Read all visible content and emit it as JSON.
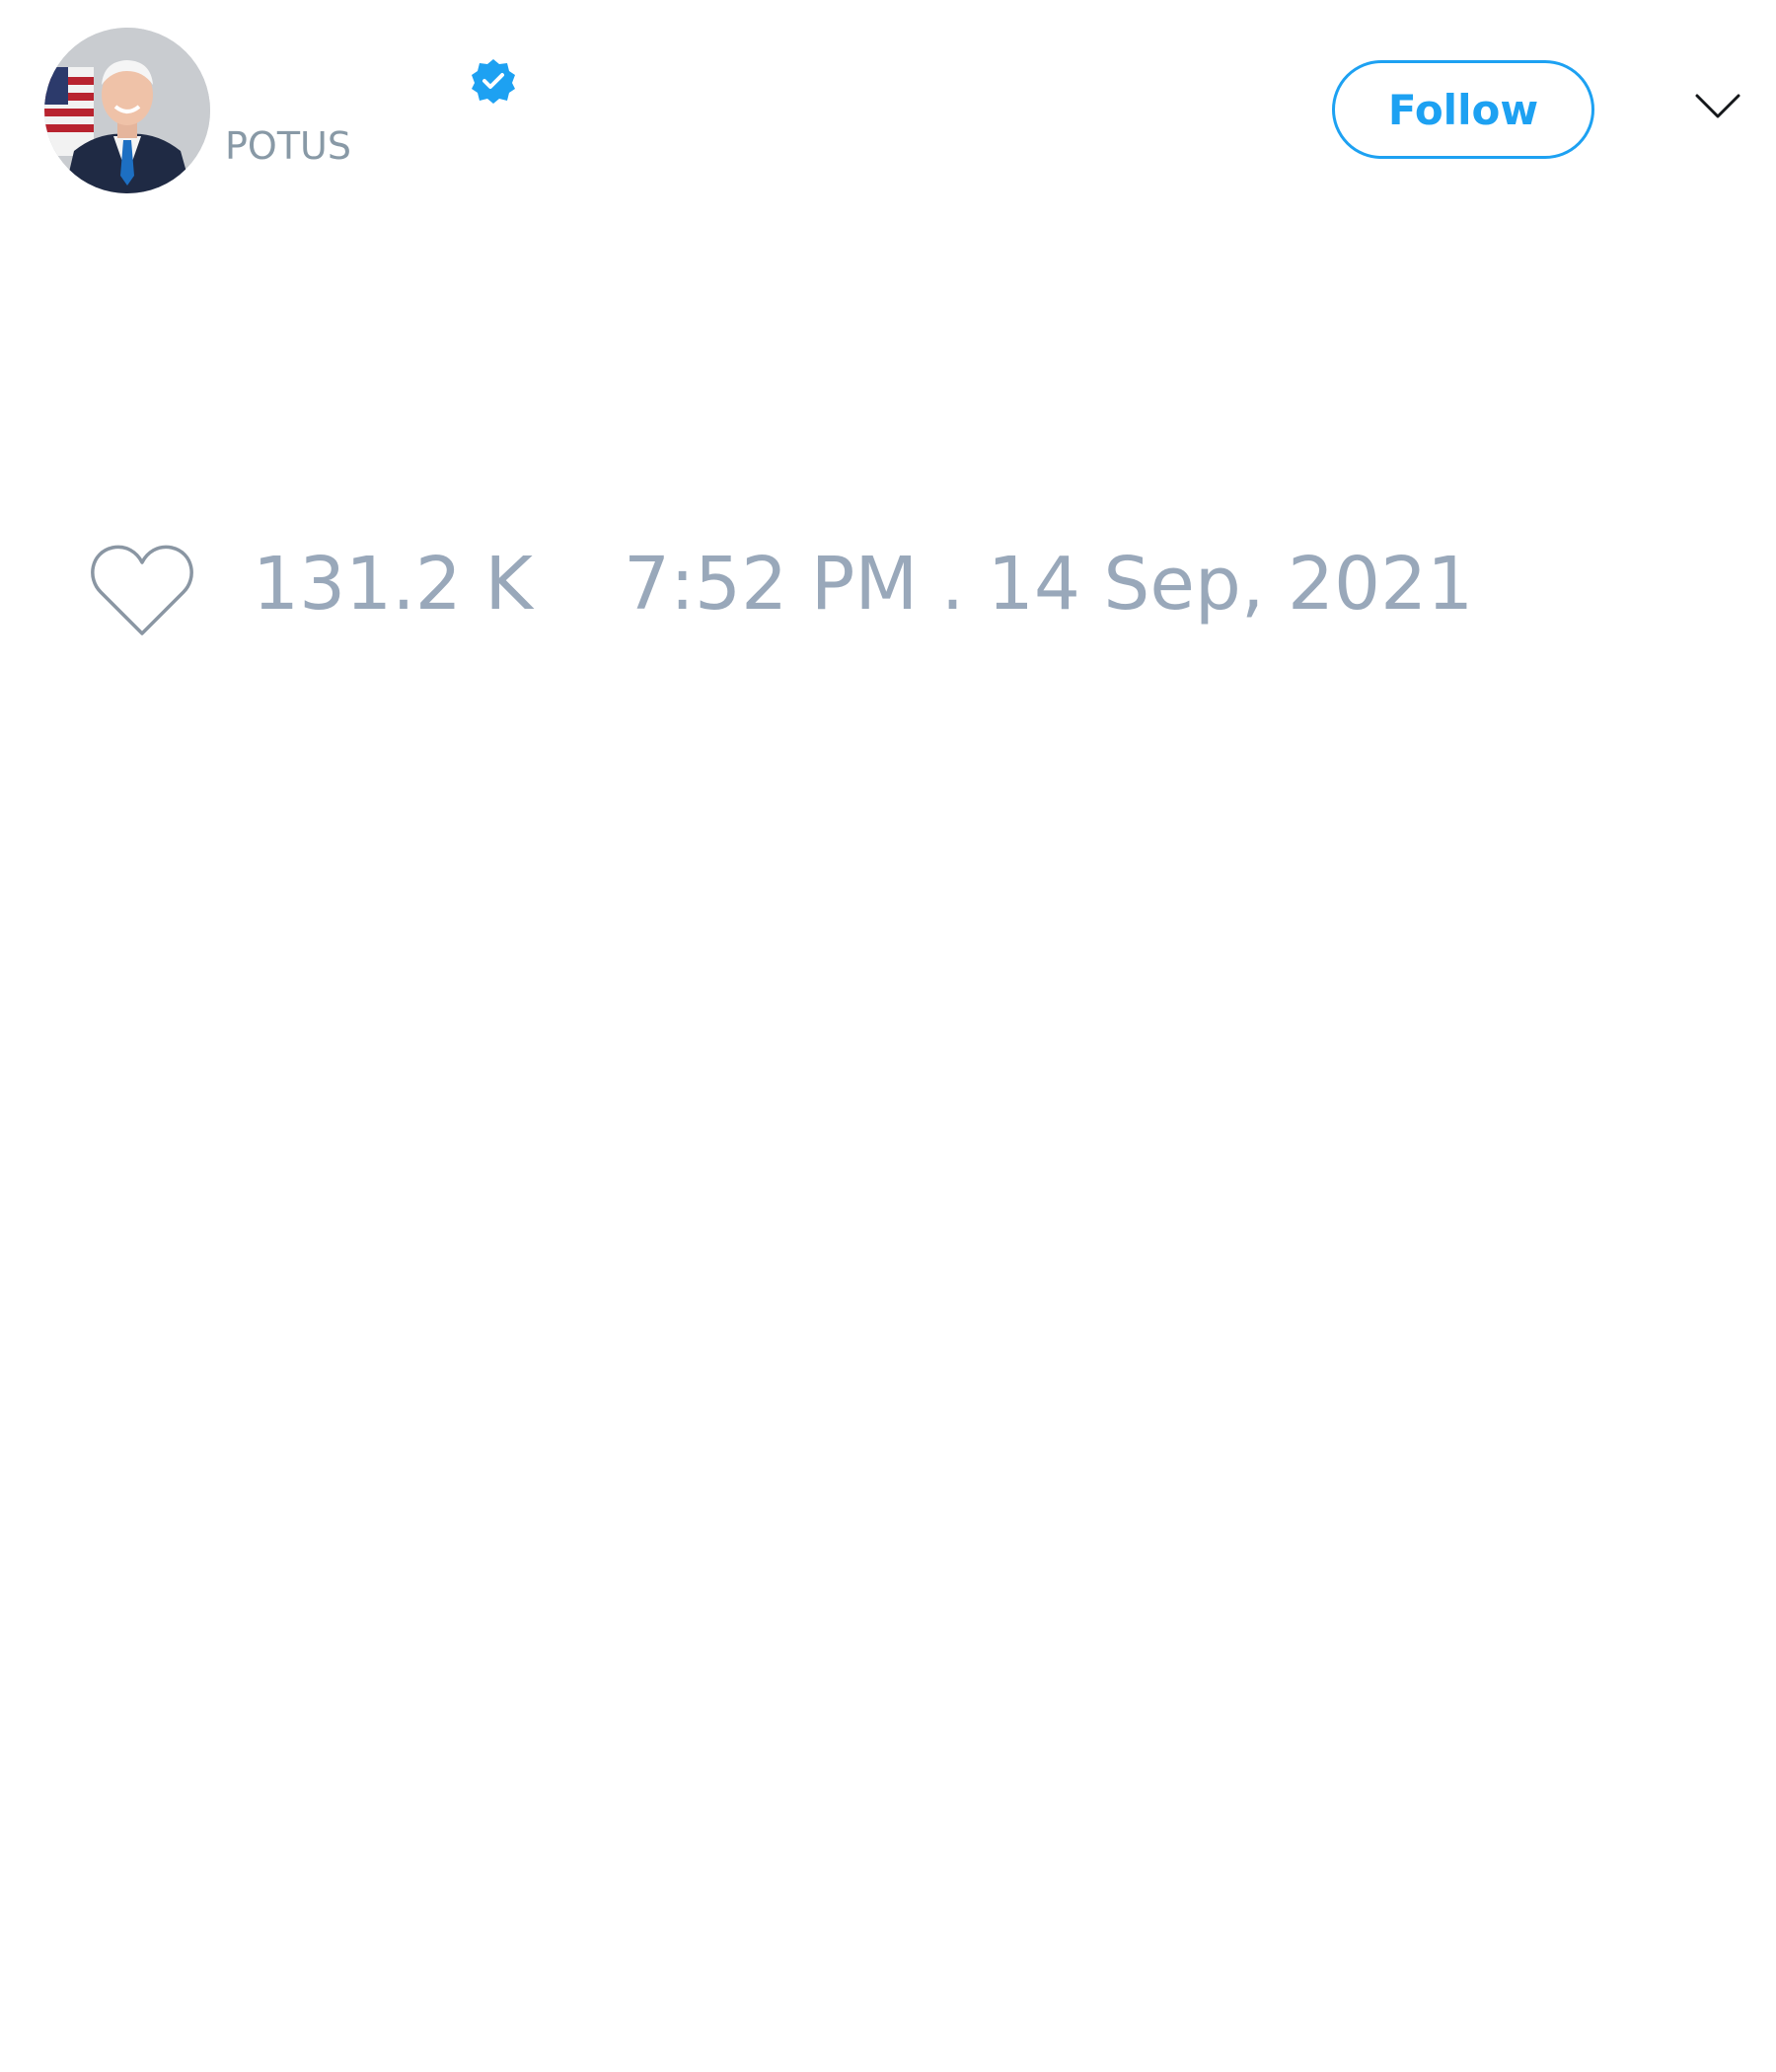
{
  "author": {
    "display_name": "",
    "handle": "POTUS",
    "verified": true,
    "avatar_icon": "portrait-photo"
  },
  "header": {
    "follow_label": "Follow",
    "menu_icon": "chevron-down-icon"
  },
  "tweet": {
    "likes": "131.2 K",
    "timestamp": "7:52 PM . 14 Sep, 2021"
  },
  "colors": {
    "accent": "#1da1f2",
    "muted_text": "#99a8ba",
    "handle_text": "#8899a6",
    "icon_stroke": "#8a96a3"
  }
}
